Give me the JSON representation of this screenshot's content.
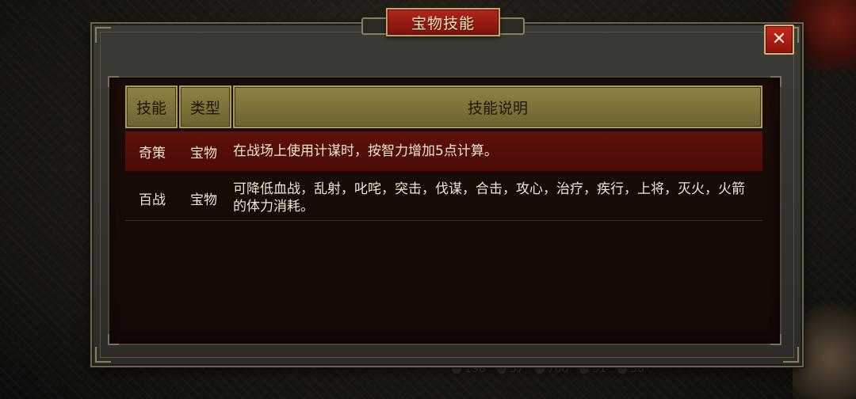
{
  "title": "宝物技能",
  "close_label": "✕",
  "table": {
    "headers": {
      "skill": "技能",
      "type": "类型",
      "desc": "技能说明"
    },
    "rows": [
      {
        "skill": "奇策",
        "type": "宝物",
        "desc": "在战场上使用计谋时，按智力增加5点计算。",
        "highlight": true
      },
      {
        "skill": "百战",
        "type": "宝物",
        "desc": "可降低血战，乱射，叱咤，突击，伐谋，合击，攻心，治疗，疾行，上将，灭火，火箭的体力消耗。",
        "highlight": false
      }
    ]
  },
  "hud": [
    "198",
    "57",
    "766",
    "31",
    "36"
  ],
  "colors": {
    "title_red": "#b3251a",
    "highlight_row": "#5e100a",
    "header_olive": "#8e8244"
  }
}
